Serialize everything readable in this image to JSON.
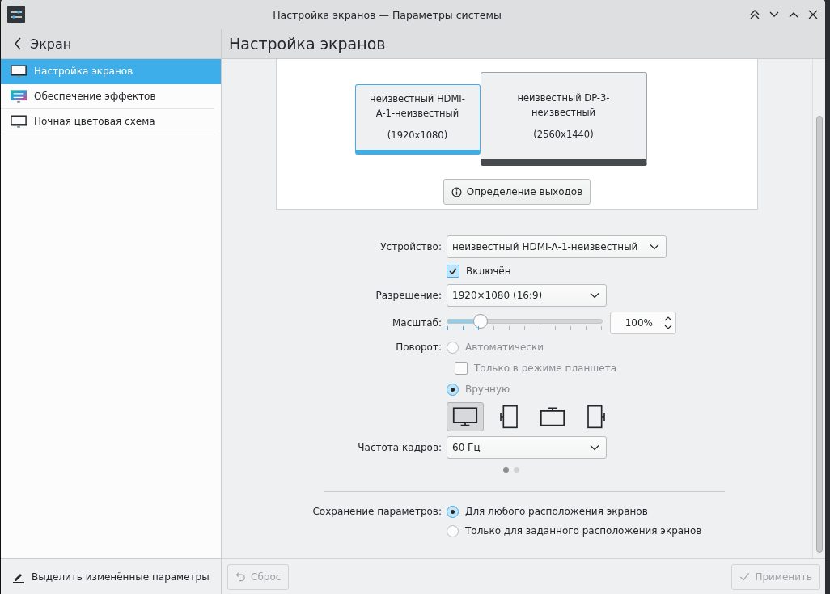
{
  "window": {
    "title": "Настройка экранов — Параметры системы"
  },
  "sidebar": {
    "title": "Экран",
    "items": [
      {
        "label": "Настройка экранов",
        "selected": true,
        "kind": "monitor"
      },
      {
        "label": "Обеспечение эффектов",
        "selected": false,
        "kind": "effects"
      },
      {
        "label": "Ночная цветовая схема",
        "selected": false,
        "kind": "monitor"
      }
    ],
    "footer_button": "Выделить изменённые параметры"
  },
  "page": {
    "title": "Настройка экранов"
  },
  "layout": {
    "outputs": [
      {
        "name": "неизвестный HDMI-A-1-неизвестный",
        "resolution": "(1920x1080)",
        "selected": true
      },
      {
        "name": "неизвестный DP-3-неизвестный",
        "resolution": "(2560x1440)",
        "selected": false
      }
    ],
    "identify_button": "Определение выходов"
  },
  "form": {
    "device": {
      "label": "Устройство:",
      "value": "неизвестный HDMI-A-1-неизвестный"
    },
    "enabled": {
      "label": "Включён",
      "checked": true
    },
    "resolution": {
      "label": "Разрешение:",
      "value": "1920×1080 (16:9)"
    },
    "scale": {
      "label": "Масштаб:",
      "level": 0.22,
      "reading": "100%"
    },
    "rotation": {
      "label": "Поворот:",
      "auto": {
        "label": "Автоматически",
        "selected": false
      },
      "tablet_only": {
        "label": "Только в режиме планшета",
        "checked": false
      },
      "manual": {
        "label": "Вручную",
        "selected": true
      },
      "orientations": [
        {
          "kind": "normal",
          "selected": true
        },
        {
          "kind": "left",
          "selected": false
        },
        {
          "kind": "inverted",
          "selected": false
        },
        {
          "kind": "right",
          "selected": false
        }
      ]
    },
    "refresh_rate": {
      "label": "Частота кадров:",
      "value": "60 Гц"
    },
    "page_dots": [
      {
        "selected": true
      },
      {
        "selected": false
      }
    ],
    "save": {
      "label": "Сохранение параметров:",
      "options": [
        {
          "label": "Для любого расположения экранов",
          "selected": true
        },
        {
          "label": "Только для заданного расположения экранов",
          "selected": false
        }
      ]
    }
  },
  "buttons": {
    "reset": {
      "label": "Сброс",
      "disabled": true
    },
    "apply": {
      "label": "Применить",
      "disabled": true
    }
  }
}
